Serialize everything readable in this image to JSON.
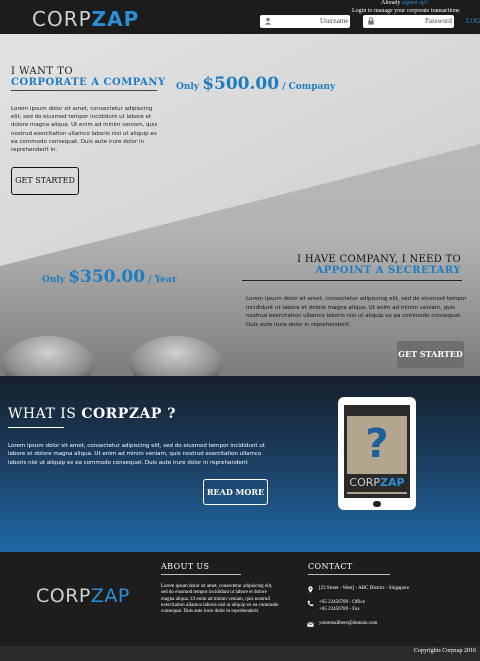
{
  "header": {
    "logo_a": "CORP",
    "logo_b": "ZAP",
    "already": "Already",
    "signed_up": "signed up?",
    "login_sub": "Login to manage your corporate transactions",
    "username_placeholder": "Username",
    "password_placeholder": "Password",
    "login_label": "LOG"
  },
  "hero": {
    "want_line1": "I WANT TO",
    "want_line2": "CORPORATE A COMPANY",
    "price1_only": "Only",
    "price1_amount": "$500.00",
    "price1_unit": "/ Company",
    "lorem1": "Lorem ipsum dolor sit amet, consectetur adipiscing elit, sed do eiusmod tempor incididunt ut labore et dolore magna aliqua. Ut enim ad minim veniam, quis nostrud exercitation ullamco laboris nisi ut aliquip ex ea commodo consequat. Duis aute irure dolor in reprehenderit in.",
    "get_started_1": "GET STARTED",
    "have_line1": "I HAVE COMPANY, I NEED TO",
    "have_line2": "APPOINT A SECRETARY",
    "price2_only": "Only",
    "price2_amount": "$350.00",
    "price2_unit": "/ Year",
    "lorem2": "Lorem ipsum dolor sit amet, consectetur adipiscing elit, sed do eiusmod tempor incididunt ut labore et dolore magna aliqua. Ut enim ad minim veniam, quis nostrud exercitation ullamco laboris nisi ut aliquip ex ea commodo consequat. Duis aute irure dolor in reprehenderit.",
    "get_started_2": "GET STARTED"
  },
  "about_band": {
    "what_is": "WHAT IS",
    "corpzap_q": "CORPZAP ?",
    "lorem": "Lorem ipsum dolor sit amet, consectetur adipiscing elit, sed do eiusmod tempor incididunt ut labore et dolore magna aliqua. Ut enim ad minim veniam, quis nostrud exercitation ullamco laboris nisi ut aliquip ex ea commodo consequat. Duis aute irure dolor in reprehenderit",
    "read_more": "READ MORE",
    "tablet_q": "?",
    "tablet_logo_a": "CORP",
    "tablet_logo_b": "ZAP"
  },
  "footer": {
    "logo_a": "CORP",
    "logo_b": "ZAP",
    "about_title": "ABOUT US",
    "about_text": "Lorem ipsum dolor sit amet, consectetur adipiscing elit, sed do eiusmod tempor incididunt ut labore et dolore magna aliqua. Ut enim ad minim veniam, quis nostrud exercitation ullamco laboris nisi ut aliquip ex ea commodo consequat. Duis aute irure dolor in reprehenderit",
    "contact_title": "CONTACT",
    "address": "[23 Street - West] - ABC District - Singapore",
    "phone_office": "+65 23456789 - Office",
    "phone_fax": "+65 23456789 - Fax",
    "email": "youremailhere@domain.com",
    "copyright": "Copyrights Corpzap 2016"
  },
  "colors": {
    "accent": "#1f7cc1",
    "header_bg": "#1c1c1c",
    "footer_bg": "#1d1d1d"
  }
}
